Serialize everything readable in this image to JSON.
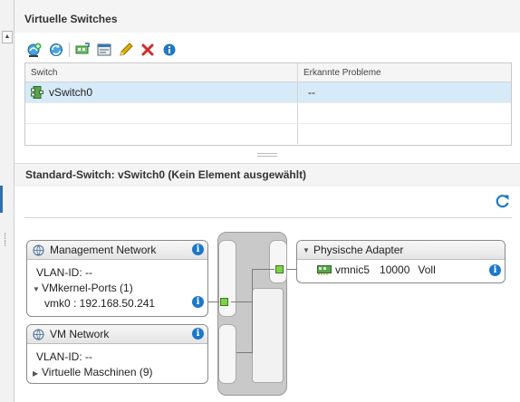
{
  "virtual_switches": {
    "title": "Virtuelle Switches",
    "toolbar": {
      "icons": [
        "add-host-networking-icon",
        "refresh-network-icon",
        "migrate-adapter-icon",
        "settings-icon",
        "edit-icon",
        "remove-icon",
        "info-icon"
      ],
      "colors": {
        "remove": "#d42a2a",
        "edit": "#e0b000",
        "info": "#1e78c8"
      }
    },
    "table": {
      "columns": [
        "Switch",
        "Erkannte Probleme"
      ],
      "rows": [
        {
          "switch": "vSwitch0",
          "issues": "--",
          "selected": true
        }
      ]
    }
  },
  "standard_switch": {
    "title": "Standard-Switch: vSwitch0 (Kein Element ausgewählt)",
    "port_groups": [
      {
        "name": "Management Network",
        "vlan": "VLAN-ID: --",
        "ports_label": "VMkernel-Ports (1)",
        "expanded": true,
        "port": "vmk0 : 192.168.50.241"
      },
      {
        "name": "VM Network",
        "vlan": "VLAN-ID: --",
        "ports_label": "Virtuelle Maschinen (9)",
        "expanded": false
      }
    ],
    "physical_adapters": {
      "title": "Physische Adapter",
      "adapters": [
        {
          "name": "vmnic5",
          "speed": "10000",
          "duplex": "Voll"
        }
      ]
    }
  },
  "colors": {
    "accent": "#1e78c8",
    "selected_row": "#d6eaf8",
    "port_green": "#7dd24a"
  }
}
